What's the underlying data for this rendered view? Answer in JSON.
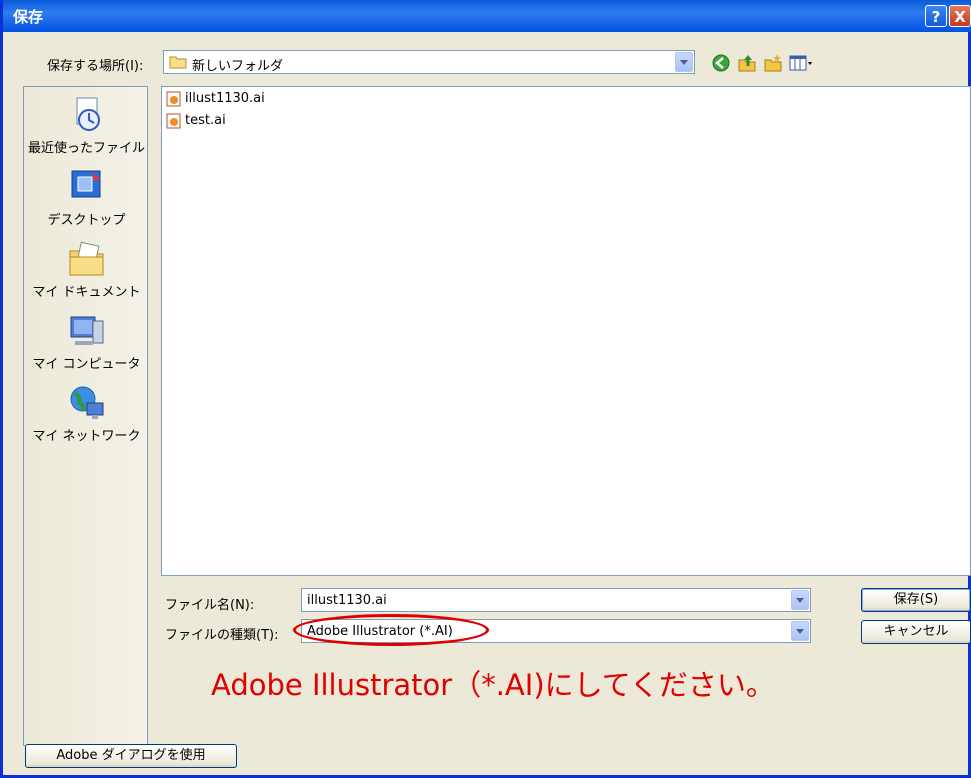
{
  "title": "保存",
  "titlebar": {
    "help_label": "?",
    "close_label": "X"
  },
  "location": {
    "label": "保存する場所(I):",
    "value": "新しいフォルダ"
  },
  "places": [
    {
      "label": "最近使ったファイル",
      "icon": "recent-icon"
    },
    {
      "label": "デスクトップ",
      "icon": "desktop-icon"
    },
    {
      "label": "マイ ドキュメント",
      "icon": "my-documents-icon"
    },
    {
      "label": "マイ コンピュータ",
      "icon": "my-computer-icon"
    },
    {
      "label": "マイ ネットワーク",
      "icon": "my-network-icon"
    }
  ],
  "files": [
    {
      "name": "illust1130.ai"
    },
    {
      "name": "test.ai"
    }
  ],
  "filename": {
    "label": "ファイル名(N):",
    "value": "illust1130.ai"
  },
  "filetype": {
    "label": "ファイルの種類(T):",
    "value": "Adobe Illustrator (*.AI)"
  },
  "buttons": {
    "save": "保存(S)",
    "cancel": "キャンセル",
    "adobe_dialog": "Adobe ダイアログを使用"
  },
  "annotation": {
    "text": "Adobe Illustrator（*.AI)にしてください。",
    "color": "#e00000"
  },
  "colors": {
    "titlebar": "#0a5bd8",
    "dialog_bg": "#ece9d8"
  }
}
